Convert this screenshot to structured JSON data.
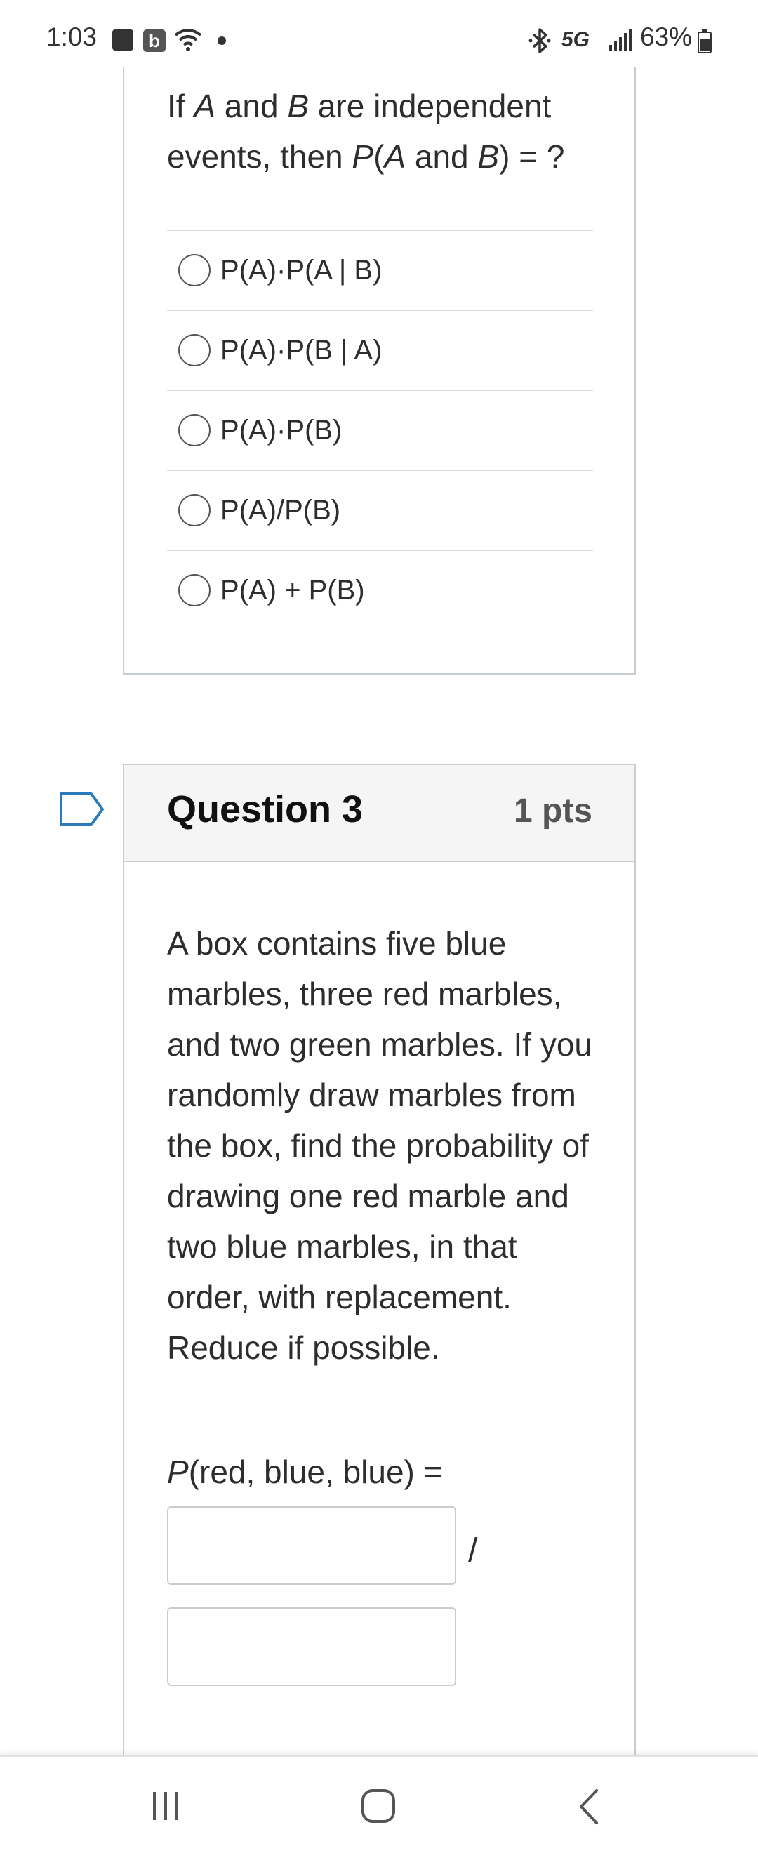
{
  "status_bar": {
    "time": "1:03",
    "b_badge": "b",
    "network": "5G",
    "battery": "63%",
    "icons": [
      "gallery-icon",
      "b-app-icon",
      "wifi-icon",
      "notification-dot-icon",
      "bluetooth-icon",
      "signal-icon",
      "battery-icon"
    ]
  },
  "question2": {
    "prompt_html": "If <i>A</i> and <i>B</i> are independent events, then <i>P</i>(<i>A</i> and <i>B</i>) = ?",
    "answers": [
      "P(A)·P(A | B)",
      "P(A)·P(B | A)",
      "P(A)·P(B)",
      "P(A)/P(B)",
      "P(A) + P(B)"
    ]
  },
  "question3": {
    "title": "Question 3",
    "points": "1 pts",
    "prompt": "A box contains five blue marbles, three red marbles, and two green marbles. If you randomly draw marbles from the box, find the probability of drawing one red marble and two blue marbles, in that order, with replacement. Reduce if possible.",
    "prob_label_italic": "P",
    "prob_label_rest": "(red, blue, blue) =",
    "numerator_value": "",
    "denominator_value": "",
    "fraction_separator": "/"
  },
  "nav_bar": {
    "icons": [
      "recents-icon",
      "home-icon",
      "back-icon"
    ]
  }
}
